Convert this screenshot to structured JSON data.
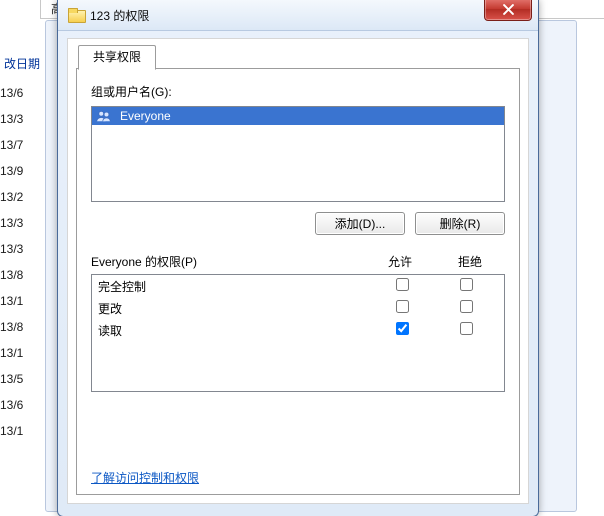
{
  "background": {
    "parent_label": "高级共享",
    "date_header": "改日期",
    "dates": [
      "13/6",
      "13/3",
      "13/7",
      "13/9",
      "13/2",
      "13/3",
      "13/3",
      "13/8",
      "13/1",
      "13/8",
      "13/1",
      "13/5",
      "13/6",
      "13/1"
    ]
  },
  "dialog": {
    "title": "123 的权限",
    "close_name": "close"
  },
  "tab": {
    "label": "共享权限"
  },
  "group_label": "组或用户名(G):",
  "users": [
    {
      "name": "Everyone"
    }
  ],
  "buttons": {
    "add": "添加(D)...",
    "remove": "删除(R)"
  },
  "perm_header": {
    "title_prefix": "Everyone 的权限(P)",
    "allow": "允许",
    "deny": "拒绝"
  },
  "permissions": [
    {
      "name": "完全控制",
      "allow": false,
      "deny": false
    },
    {
      "name": "更改",
      "allow": false,
      "deny": false
    },
    {
      "name": "读取",
      "allow": true,
      "deny": false
    }
  ],
  "link": {
    "label": "了解访问控制和权限"
  }
}
